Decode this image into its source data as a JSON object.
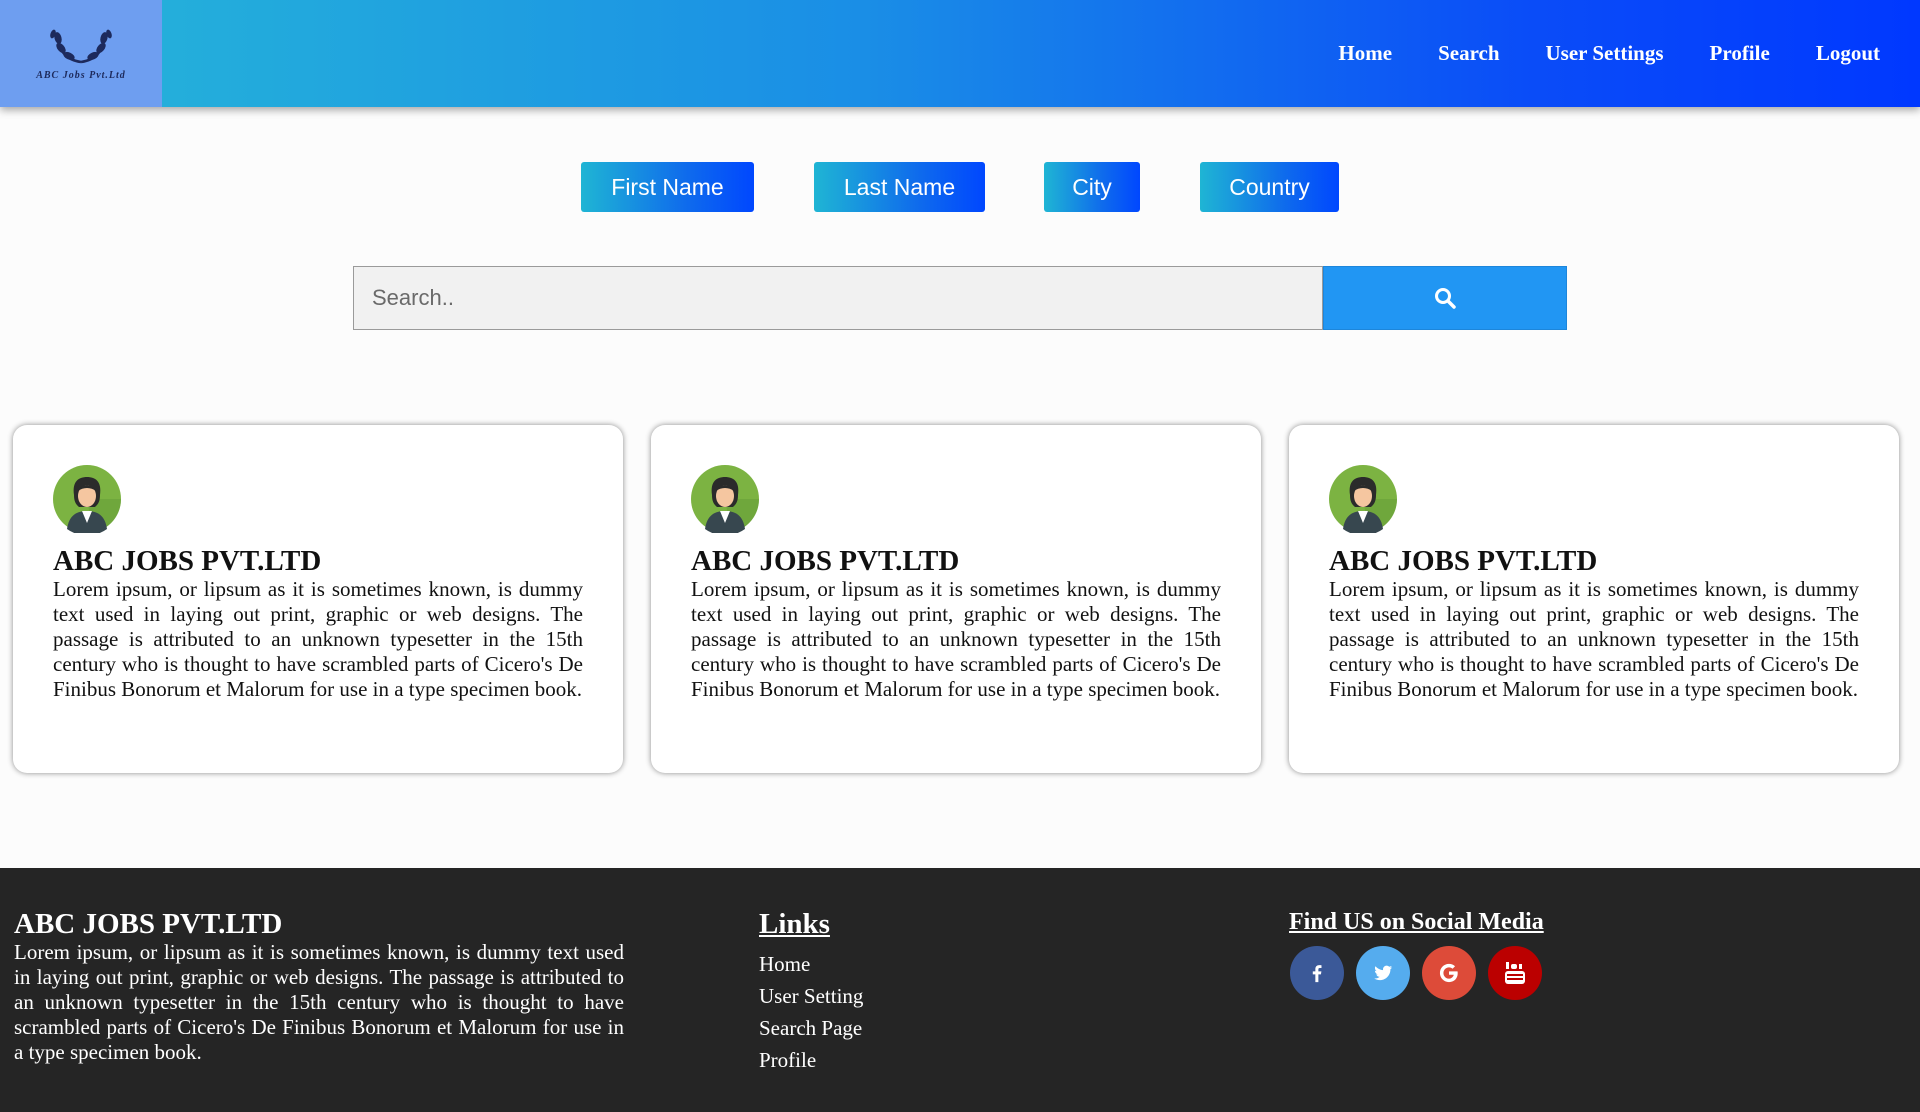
{
  "header": {
    "logo_text": "ABC Jobs Pvt.Ltd",
    "nav": [
      "Home",
      "Search",
      "User Settings",
      "Profile",
      "Logout"
    ]
  },
  "filters": [
    "First Name",
    "Last Name",
    "City",
    "Country"
  ],
  "search": {
    "placeholder": "Search.."
  },
  "cards": [
    {
      "title": "ABC JOBS PVT.LTD",
      "text": "Lorem ipsum, or lipsum as it is sometimes known, is dummy text used in laying out print, graphic or web designs. The passage is attributed to an unknown typesetter in the 15th century who is thought to have scrambled parts of Cicero's De Finibus Bonorum et Malorum for use in a type specimen book."
    },
    {
      "title": "ABC JOBS PVT.LTD",
      "text": "Lorem ipsum, or lipsum as it is sometimes known, is dummy text used in laying out print, graphic or web designs. The passage is attributed to an unknown typesetter in the 15th century who is thought to have scrambled parts of Cicero's De Finibus Bonorum et Malorum for use in a type specimen book."
    },
    {
      "title": "ABC JOBS PVT.LTD",
      "text": "Lorem ipsum, or lipsum as it is sometimes known, is dummy text used in laying out print, graphic or web designs. The passage is attributed to an unknown typesetter in the 15th century who is thought to have scrambled parts of Cicero's De Finibus Bonorum et Malorum for use in a type specimen book."
    }
  ],
  "footer": {
    "title": "ABC JOBS PVT.LTD",
    "text": "Lorem ipsum, or lipsum as it is sometimes known, is dummy text used in laying out print, graphic or web designs. The passage is attributed to an unknown typesetter in the 15th century who is thought to have scrambled parts of Cicero's De Finibus Bonorum et Malorum for use in a type specimen book.",
    "links_heading": "Links",
    "links": [
      "Home",
      "User Setting",
      "Search Page",
      "Profile"
    ],
    "social_heading": "Find US on Social Media",
    "social": [
      {
        "icon": "facebook-icon",
        "color": "#3b5998"
      },
      {
        "icon": "twitter-icon",
        "color": "#55acee"
      },
      {
        "icon": "google-icon",
        "color": "#dd4b39"
      },
      {
        "icon": "youtube-icon",
        "color": "#bb0000"
      }
    ]
  },
  "colors": {
    "accent_blue": "#2196f3",
    "header_gradient_start": "#26b6d8",
    "header_gradient_end": "#0038ff",
    "footer_bg": "#252525"
  }
}
